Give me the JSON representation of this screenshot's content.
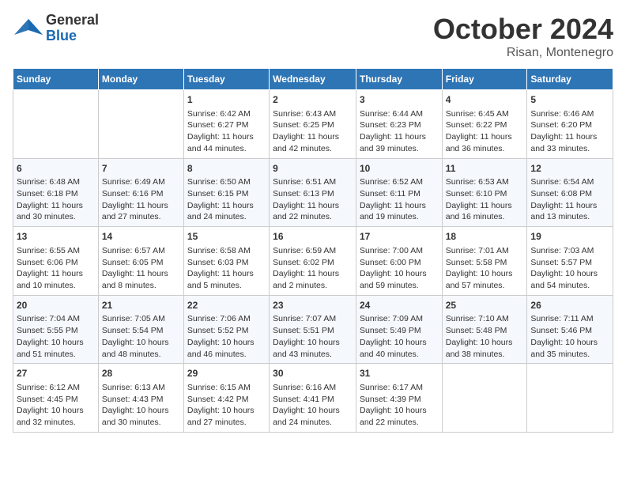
{
  "header": {
    "logo_general": "General",
    "logo_blue": "Blue",
    "month": "October 2024",
    "location": "Risan, Montenegro"
  },
  "weekdays": [
    "Sunday",
    "Monday",
    "Tuesday",
    "Wednesday",
    "Thursday",
    "Friday",
    "Saturday"
  ],
  "weeks": [
    [
      {
        "day": "",
        "info": ""
      },
      {
        "day": "",
        "info": ""
      },
      {
        "day": "1",
        "info": "Sunrise: 6:42 AM\nSunset: 6:27 PM\nDaylight: 11 hours\nand 44 minutes."
      },
      {
        "day": "2",
        "info": "Sunrise: 6:43 AM\nSunset: 6:25 PM\nDaylight: 11 hours\nand 42 minutes."
      },
      {
        "day": "3",
        "info": "Sunrise: 6:44 AM\nSunset: 6:23 PM\nDaylight: 11 hours\nand 39 minutes."
      },
      {
        "day": "4",
        "info": "Sunrise: 6:45 AM\nSunset: 6:22 PM\nDaylight: 11 hours\nand 36 minutes."
      },
      {
        "day": "5",
        "info": "Sunrise: 6:46 AM\nSunset: 6:20 PM\nDaylight: 11 hours\nand 33 minutes."
      }
    ],
    [
      {
        "day": "6",
        "info": "Sunrise: 6:48 AM\nSunset: 6:18 PM\nDaylight: 11 hours\nand 30 minutes."
      },
      {
        "day": "7",
        "info": "Sunrise: 6:49 AM\nSunset: 6:16 PM\nDaylight: 11 hours\nand 27 minutes."
      },
      {
        "day": "8",
        "info": "Sunrise: 6:50 AM\nSunset: 6:15 PM\nDaylight: 11 hours\nand 24 minutes."
      },
      {
        "day": "9",
        "info": "Sunrise: 6:51 AM\nSunset: 6:13 PM\nDaylight: 11 hours\nand 22 minutes."
      },
      {
        "day": "10",
        "info": "Sunrise: 6:52 AM\nSunset: 6:11 PM\nDaylight: 11 hours\nand 19 minutes."
      },
      {
        "day": "11",
        "info": "Sunrise: 6:53 AM\nSunset: 6:10 PM\nDaylight: 11 hours\nand 16 minutes."
      },
      {
        "day": "12",
        "info": "Sunrise: 6:54 AM\nSunset: 6:08 PM\nDaylight: 11 hours\nand 13 minutes."
      }
    ],
    [
      {
        "day": "13",
        "info": "Sunrise: 6:55 AM\nSunset: 6:06 PM\nDaylight: 11 hours\nand 10 minutes."
      },
      {
        "day": "14",
        "info": "Sunrise: 6:57 AM\nSunset: 6:05 PM\nDaylight: 11 hours\nand 8 minutes."
      },
      {
        "day": "15",
        "info": "Sunrise: 6:58 AM\nSunset: 6:03 PM\nDaylight: 11 hours\nand 5 minutes."
      },
      {
        "day": "16",
        "info": "Sunrise: 6:59 AM\nSunset: 6:02 PM\nDaylight: 11 hours\nand 2 minutes."
      },
      {
        "day": "17",
        "info": "Sunrise: 7:00 AM\nSunset: 6:00 PM\nDaylight: 10 hours\nand 59 minutes."
      },
      {
        "day": "18",
        "info": "Sunrise: 7:01 AM\nSunset: 5:58 PM\nDaylight: 10 hours\nand 57 minutes."
      },
      {
        "day": "19",
        "info": "Sunrise: 7:03 AM\nSunset: 5:57 PM\nDaylight: 10 hours\nand 54 minutes."
      }
    ],
    [
      {
        "day": "20",
        "info": "Sunrise: 7:04 AM\nSunset: 5:55 PM\nDaylight: 10 hours\nand 51 minutes."
      },
      {
        "day": "21",
        "info": "Sunrise: 7:05 AM\nSunset: 5:54 PM\nDaylight: 10 hours\nand 48 minutes."
      },
      {
        "day": "22",
        "info": "Sunrise: 7:06 AM\nSunset: 5:52 PM\nDaylight: 10 hours\nand 46 minutes."
      },
      {
        "day": "23",
        "info": "Sunrise: 7:07 AM\nSunset: 5:51 PM\nDaylight: 10 hours\nand 43 minutes."
      },
      {
        "day": "24",
        "info": "Sunrise: 7:09 AM\nSunset: 5:49 PM\nDaylight: 10 hours\nand 40 minutes."
      },
      {
        "day": "25",
        "info": "Sunrise: 7:10 AM\nSunset: 5:48 PM\nDaylight: 10 hours\nand 38 minutes."
      },
      {
        "day": "26",
        "info": "Sunrise: 7:11 AM\nSunset: 5:46 PM\nDaylight: 10 hours\nand 35 minutes."
      }
    ],
    [
      {
        "day": "27",
        "info": "Sunrise: 6:12 AM\nSunset: 4:45 PM\nDaylight: 10 hours\nand 32 minutes."
      },
      {
        "day": "28",
        "info": "Sunrise: 6:13 AM\nSunset: 4:43 PM\nDaylight: 10 hours\nand 30 minutes."
      },
      {
        "day": "29",
        "info": "Sunrise: 6:15 AM\nSunset: 4:42 PM\nDaylight: 10 hours\nand 27 minutes."
      },
      {
        "day": "30",
        "info": "Sunrise: 6:16 AM\nSunset: 4:41 PM\nDaylight: 10 hours\nand 24 minutes."
      },
      {
        "day": "31",
        "info": "Sunrise: 6:17 AM\nSunset: 4:39 PM\nDaylight: 10 hours\nand 22 minutes."
      },
      {
        "day": "",
        "info": ""
      },
      {
        "day": "",
        "info": ""
      }
    ]
  ]
}
